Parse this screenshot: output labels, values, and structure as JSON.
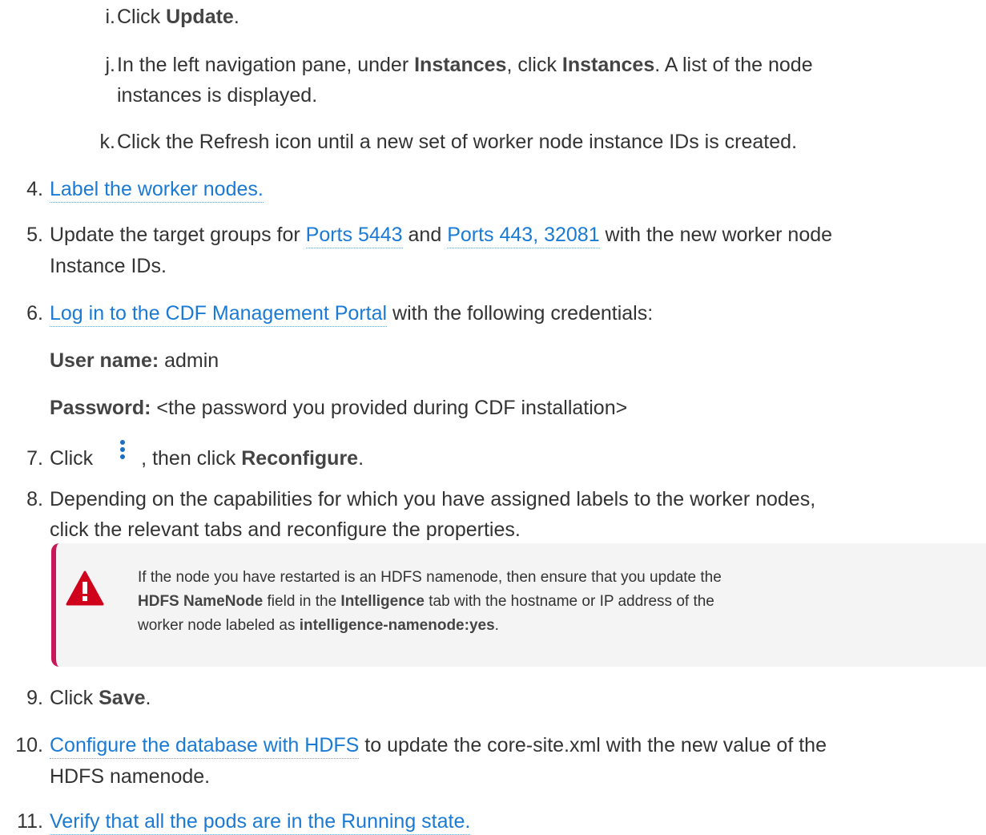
{
  "steps": {
    "i": {
      "marker": "i.",
      "pre": "Click ",
      "bold": "Update",
      "post": "."
    },
    "j": {
      "marker": "j.",
      "pre": "In the left navigation pane, under ",
      "bold1": "Instances",
      "mid": ", click ",
      "bold2": "Instances",
      "post": ". A list of the node",
      "line2": "instances is displayed."
    },
    "k": {
      "marker": "k.",
      "text": "Click the Refresh icon until a new set of worker node instance IDs is created."
    },
    "s4": {
      "marker": "4.",
      "link": "Label the worker nodes."
    },
    "s5": {
      "marker": "5.",
      "pre": "Update the target groups for ",
      "link1": "Ports 5443",
      "mid": " and ",
      "link2": "Ports 443, 32081",
      "post": " with the new worker node",
      "line2": "Instance IDs."
    },
    "s6": {
      "marker": "6.",
      "link": "Log in to the CDF Management Portal",
      "post": " with the following credentials:",
      "user_label": "User name:",
      "user_value": " admin",
      "pass_label": "Password:",
      "pass_value": " <the password you provided during CDF installation>"
    },
    "s7": {
      "marker": "7.",
      "pre": "Click",
      "post": ", then click ",
      "bold": "Reconfigure",
      "end": ".",
      "icon": "kebab-menu-icon"
    },
    "s8": {
      "marker": "8.",
      "line1": "Depending on the capabilities for which you have assigned labels to the worker nodes,",
      "line2": "click the relevant tabs and reconfigure the properties."
    },
    "note": {
      "icon": "warning-icon",
      "t1": "If the node you have restarted is an HDFS namenode, then ensure that you update the",
      "b1": "HDFS NameNode",
      "t2": " field in the ",
      "b2": "Intelligence",
      "t3": " tab with the hostname or IP address of the",
      "t4": "worker node labeled as ",
      "b3": "intelligence-namenode:yes",
      "t5": "."
    },
    "s9": {
      "marker": "9.",
      "pre": "Click ",
      "bold": "Save",
      "post": "."
    },
    "s10": {
      "marker": "10.",
      "link": "Configure the database with HDFS",
      "post": " to update the core-site.xml with the new value of the",
      "line2": "HDFS namenode."
    },
    "s11": {
      "marker": "11.",
      "link": "Verify that all the pods are in the Running state."
    }
  },
  "colors": {
    "link": "#1a7ad4",
    "note_border": "#c8185a",
    "note_bg": "#f4f4f4",
    "warning": "#d0021b"
  }
}
